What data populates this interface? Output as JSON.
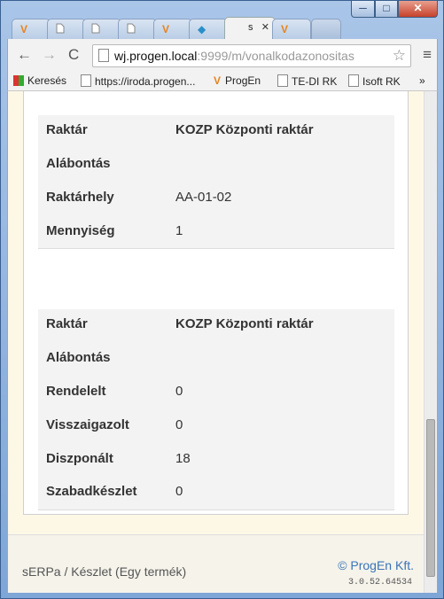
{
  "window": {
    "controls": {
      "minimize": "─",
      "maximize": "□",
      "close": "✕"
    }
  },
  "tabs": [
    {
      "icon": "progen-v-icon",
      "glyph": "V",
      "title": ""
    },
    {
      "icon": "document-icon",
      "glyph": "",
      "title": ""
    },
    {
      "icon": "document-icon",
      "glyph": "",
      "title": ""
    },
    {
      "icon": "document-icon",
      "glyph": "",
      "title": ""
    },
    {
      "icon": "progen-v-icon",
      "glyph": "V",
      "title": ""
    },
    {
      "icon": "app-icon",
      "glyph": "◆",
      "title": ""
    },
    {
      "icon": "document-icon",
      "glyph": "",
      "title": "s",
      "active": true,
      "close": "✕"
    },
    {
      "icon": "progen-v-icon",
      "glyph": "V",
      "title": ""
    },
    {
      "icon": "new-tab",
      "glyph": "",
      "title": ""
    }
  ],
  "toolbar": {
    "back": "←",
    "forward": "→",
    "reload": "C",
    "url_domain": "wj.progen.local",
    "url_rest": ":9999/m/vonalkodazonositas",
    "star": "☆",
    "menu": "≡"
  },
  "bookmarks": [
    {
      "label": "Keresés",
      "icon": "grid-icon"
    },
    {
      "label": "https://iroda.progen...",
      "icon": "document-icon"
    },
    {
      "label": "ProgEn",
      "icon": "progen-v-icon"
    },
    {
      "label": "TE-DI RK",
      "icon": "document-icon"
    },
    {
      "label": "Isoft RK",
      "icon": "document-icon"
    },
    {
      "label": "»",
      "icon": ""
    }
  ],
  "card1": {
    "rows": [
      {
        "label": "Raktár",
        "value": "KOZP Központi raktár",
        "bold": true
      },
      {
        "label": "Alábontás",
        "value": ""
      },
      {
        "label": "Raktárhely",
        "value": "AA-01-02"
      },
      {
        "label": "Mennyiség",
        "value": "1"
      }
    ]
  },
  "card2": {
    "rows": [
      {
        "label": "Raktár",
        "value": "KOZP Központi raktár",
        "bold": true
      },
      {
        "label": "Alábontás",
        "value": ""
      },
      {
        "label": "Rendelelt",
        "value": "0"
      },
      {
        "label": "Visszaigazolt",
        "value": "0"
      },
      {
        "label": "Diszponált",
        "value": "18"
      },
      {
        "label": "Szabadkészlet",
        "value": "0"
      }
    ]
  },
  "footer": {
    "breadcrumb": "sERPa / Készlet (Egy termék)",
    "copyright": "© ProgEn Kft.",
    "version": "3.0.52.64534"
  }
}
